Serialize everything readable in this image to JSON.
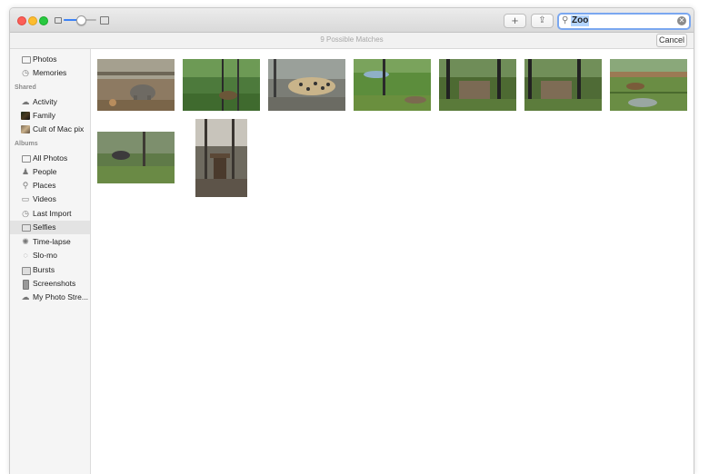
{
  "search": {
    "value": "Zoo",
    "search_icon": "magnifier-icon",
    "clear_icon": "clear-icon"
  },
  "toolbar": {
    "add_label": "+",
    "share_label": "⇪"
  },
  "results": {
    "matches_label": "9 Possible Matches",
    "cancel_label": "Cancel"
  },
  "sidebar": {
    "top_items": [
      {
        "label": "Photos",
        "icon": "photos-icon"
      },
      {
        "label": "Memories",
        "icon": "memories-icon"
      }
    ],
    "shared_heading": "Shared",
    "shared_items": [
      {
        "label": "Activity",
        "icon": "cloud-icon"
      },
      {
        "label": "Family",
        "icon": "album-thumbnail"
      },
      {
        "label": "Cult of Mac pix",
        "icon": "album-thumbnail"
      }
    ],
    "albums_heading": "Albums",
    "album_items": [
      {
        "label": "All Photos",
        "icon": "photos-icon"
      },
      {
        "label": "People",
        "icon": "person-icon"
      },
      {
        "label": "Places",
        "icon": "pin-icon"
      },
      {
        "label": "Videos",
        "icon": "video-icon"
      },
      {
        "label": "Last Import",
        "icon": "clock-icon"
      },
      {
        "label": "Selfies",
        "icon": "camera-icon",
        "selected": true
      },
      {
        "label": "Time-lapse",
        "icon": "time-lapse-icon"
      },
      {
        "label": "Slo-mo",
        "icon": "slo-mo-icon"
      },
      {
        "label": "Bursts",
        "icon": "bursts-icon"
      },
      {
        "label": "Screenshots",
        "icon": "phone-icon"
      },
      {
        "label": "My Photo Stre...",
        "icon": "cloud-icon"
      }
    ]
  },
  "photos": [
    {
      "subject": "elephant"
    },
    {
      "subject": "fence-greenery"
    },
    {
      "subject": "leopard"
    },
    {
      "subject": "pond"
    },
    {
      "subject": "fence-gate"
    },
    {
      "subject": "fence-gate"
    },
    {
      "subject": "capybara"
    },
    {
      "subject": "animal-field"
    },
    {
      "subject": "bird-in-cage"
    }
  ]
}
